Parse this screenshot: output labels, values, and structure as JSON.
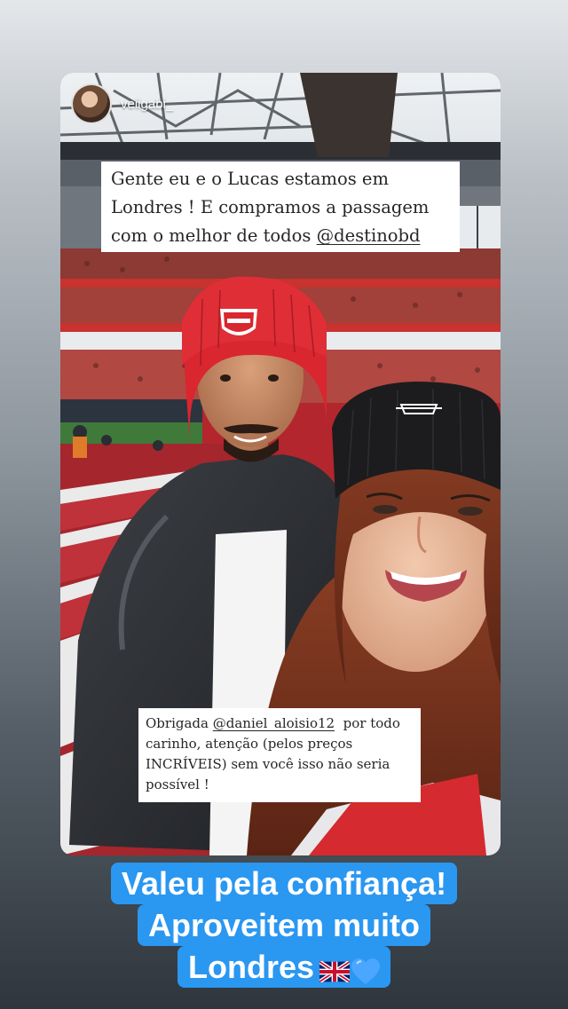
{
  "story": {
    "username": "veiigabi_",
    "caption_top": {
      "line1": "Gente eu e o Lucas estamos em",
      "line2": "Londres ! E compramos a passagem",
      "line3_text": "com o melhor de todos ",
      "line3_mention": "@destinobd"
    },
    "caption_bottom": {
      "line1_text": "Obrigada ",
      "line1_mention": "@daniel_aloisio12",
      "line1_tail": "  por todo",
      "line2": "carinho, atenção (pelos preços",
      "line3": "INCRÍVEIS) sem você isso não seria",
      "line4": "possível !"
    }
  },
  "blue_caption": {
    "line1": "Valeu pela confiança!",
    "line2": "Aproveitem muito",
    "line3": "Londres"
  },
  "icons": [
    "uk-flag-icon",
    "blue-heart-icon",
    "arsenal-crest-icon"
  ],
  "colors": {
    "caption_bg": "#2a97f1",
    "beanie_red": "#d9262f",
    "beanie_black": "#1c1c1e",
    "seat_red": "#b52a30"
  }
}
